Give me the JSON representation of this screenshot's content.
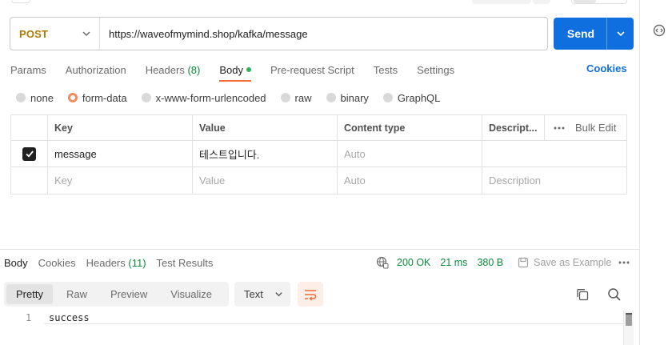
{
  "request": {
    "method": "POST",
    "url": "https://waveofmymind.shop/kafka/message",
    "send_label": "Send"
  },
  "tabs": [
    {
      "label": "Params"
    },
    {
      "label": "Authorization"
    },
    {
      "label": "Headers",
      "count": "(8)"
    },
    {
      "label": "Body",
      "dot": true
    },
    {
      "label": "Pre-request Script"
    },
    {
      "label": "Tests"
    },
    {
      "label": "Settings"
    }
  ],
  "cookies_label": "Cookies",
  "body_types": [
    {
      "label": "none",
      "checked": false
    },
    {
      "label": "form-data",
      "checked": true
    },
    {
      "label": "x-www-form-urlencoded",
      "checked": false
    },
    {
      "label": "raw",
      "checked": false
    },
    {
      "label": "binary",
      "checked": false
    },
    {
      "label": "GraphQL",
      "checked": false
    }
  ],
  "table": {
    "headers": {
      "key": "Key",
      "value": "Value",
      "content_type": "Content type",
      "description": "Descript...",
      "bulk_edit": "Bulk Edit"
    },
    "rows": [
      {
        "checked": true,
        "key": "message",
        "value": "테스트입니다.",
        "content_type": "Auto",
        "description": ""
      }
    ],
    "placeholder_row": {
      "key": "Key",
      "value": "Value",
      "content_type": "Auto",
      "description": "Description"
    }
  },
  "response": {
    "tabs": [
      {
        "label": "Body"
      },
      {
        "label": "Cookies"
      },
      {
        "label": "Headers",
        "count": "(11)"
      },
      {
        "label": "Test Results"
      }
    ],
    "status": "200 OK",
    "time": "21 ms",
    "size": "380 B",
    "save_example": "Save as Example",
    "views": [
      "Pretty",
      "Raw",
      "Preview",
      "Visualize"
    ],
    "format": "Text",
    "code_lines": [
      {
        "num": "1",
        "text": "success"
      }
    ]
  },
  "colors": {
    "accent": "#ff6c37",
    "send_button": "#0f6fde",
    "method_post": "#ad7a03",
    "status_ok": "#0b8a3c"
  }
}
